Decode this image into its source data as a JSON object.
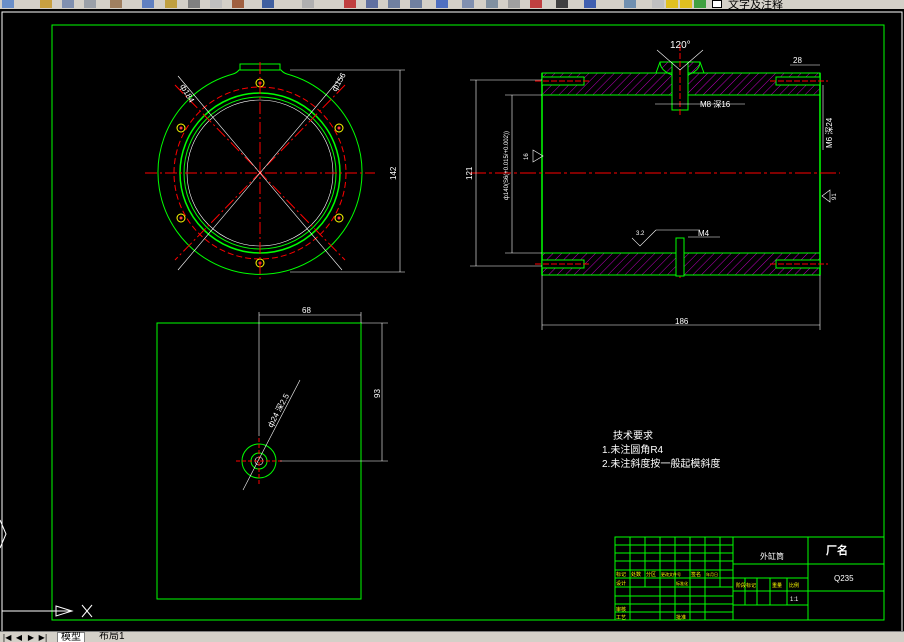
{
  "toolbar": {
    "text_style_label": "文字及注释",
    "colors": {
      "bg": "#d4d0c8"
    }
  },
  "drawing": {
    "colors": {
      "background": "#000000",
      "frame": "#00ff00",
      "outline": "#00ff00",
      "dimension": "#ffffff",
      "centerline": "#ff0000",
      "hatch": "#c000c0",
      "text": "#ffffff",
      "accent": "#ffff00"
    },
    "front_view": {
      "dim_bolt_circle": "ф184",
      "dim_bore": "ф156",
      "dim_height": "142"
    },
    "section_view": {
      "dim_angle": "120°",
      "dim_right": "28",
      "thread_m8": "M8  深16",
      "thread_m6": "M6  深24",
      "dim_left_outer": "121",
      "dim_inner": "ф140(S6(+0.015/+0.002))",
      "roughness_left": "16",
      "roughness_right": "91",
      "roughness_small": "3.2",
      "thread_m4": "M4",
      "dim_length": "186"
    },
    "plate_view": {
      "dim_width": "68",
      "dim_height": "93",
      "dim_hole": "ф24  深2.5"
    },
    "tech_requirements": {
      "title": "技术要求",
      "item1": "1.未注圆角R4",
      "item2": "2.未注斜度按一般起模斜度"
    },
    "title_block": {
      "part_name": "外缸筒",
      "company": "厂名",
      "material": "Q235",
      "scale": "1:1",
      "labels": [
        "标记",
        "处数",
        "分区",
        "更改文件号",
        "签名",
        "年月日",
        "设计",
        "标准化",
        "阶段标记",
        "重量",
        "比例",
        "审核",
        "工艺",
        "批准"
      ]
    }
  },
  "tabs": {
    "model": "模型",
    "layout1": "布局1"
  }
}
